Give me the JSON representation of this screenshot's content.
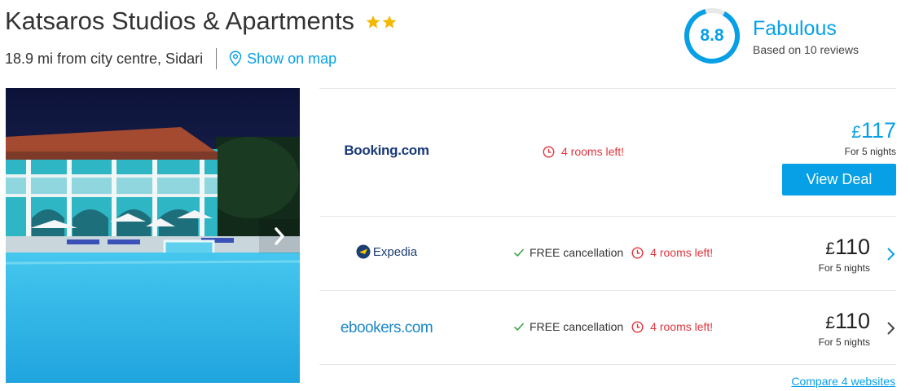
{
  "hotel": {
    "name": "Katsaros Studios & Apartments",
    "star_count": 2,
    "star_color": "#f5b800",
    "distance": "18.9 mi from city centre, Sidari",
    "map_link": "Show on map"
  },
  "rating": {
    "score": "8.8",
    "label": "Fabulous",
    "reviews": "Based on 10 reviews",
    "accent_color": "#07a0e6"
  },
  "deals": [
    {
      "provider": "Booking.com",
      "rooms_left": "4 rooms left!",
      "currency": "£",
      "amount": "117",
      "nights": "For 5 nights",
      "button": "View Deal"
    },
    {
      "provider": "Expedia",
      "free_cancellation": "FREE cancellation",
      "rooms_left": "4 rooms left!",
      "currency": "£",
      "amount": "110",
      "nights": "For 5 nights"
    },
    {
      "provider": "ebookers.com",
      "free_cancellation": "FREE cancellation",
      "rooms_left": "4 rooms left!",
      "currency": "£",
      "amount": "110",
      "nights": "For 5 nights"
    }
  ],
  "compare_link": "Compare 4 websites"
}
